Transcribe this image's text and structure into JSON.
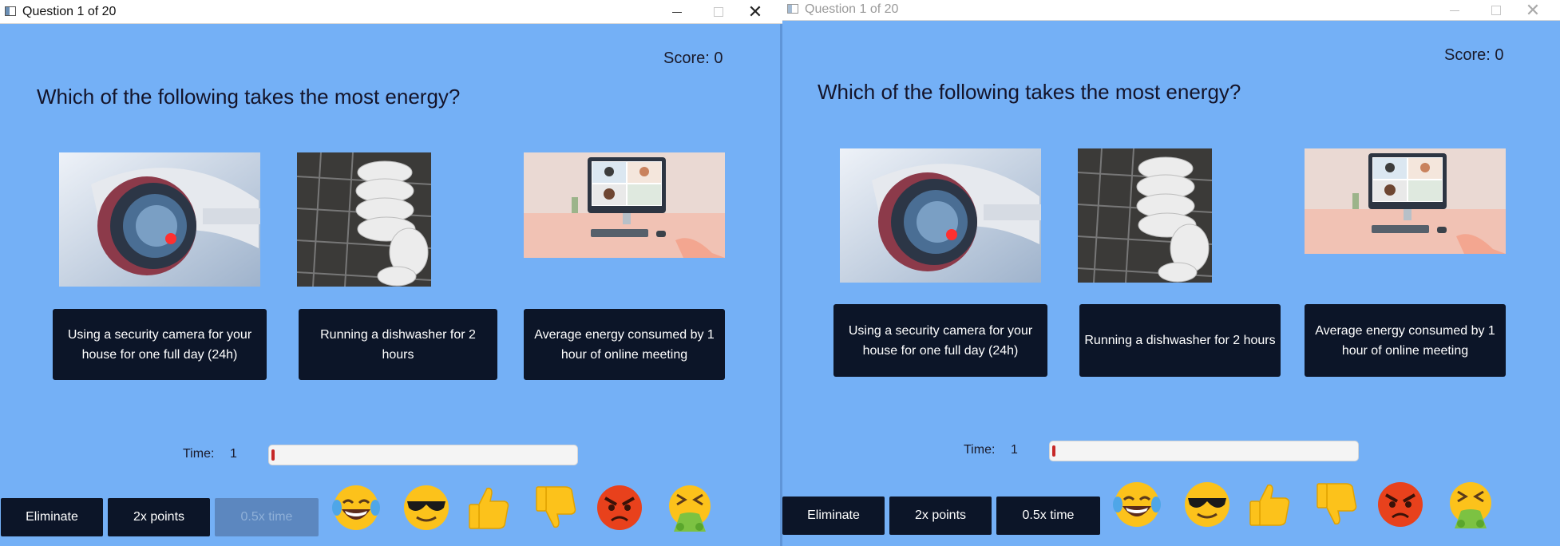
{
  "windows": [
    {
      "title": "Question 1 of 20",
      "score_label": "Score: 0",
      "question": "Which of the following takes the most energy?",
      "answers": [
        {
          "label": "Using a security camera for your house for one full day (24h)",
          "image": "security-camera"
        },
        {
          "label": "Running a dishwasher for 2 hours",
          "image": "dishwasher"
        },
        {
          "label": "Average energy consumed by 1 hour of online meeting",
          "image": "online-meeting"
        }
      ],
      "time_label": "Time:",
      "time_value": "1",
      "time_progress": 0.01,
      "powerups": [
        {
          "label": "Eliminate",
          "enabled": true
        },
        {
          "label": "2x points",
          "enabled": true
        },
        {
          "label": "0.5x time",
          "enabled": false
        }
      ],
      "reactions": [
        "laughing-crying-emoji",
        "sunglasses-emoji",
        "thumbs-up-emoji",
        "thumbs-down-emoji",
        "angry-emoji",
        "vomiting-emoji"
      ]
    },
    {
      "title": "Question 1 of 20",
      "score_label": "Score: 0",
      "question": "Which of the following takes the most energy?",
      "answers": [
        {
          "label": "Using a security camera for your house for one full day (24h)",
          "image": "security-camera"
        },
        {
          "label": "Running a dishwasher for 2 hours",
          "image": "dishwasher"
        },
        {
          "label": "Average energy consumed by 1 hour of online meeting",
          "image": "online-meeting"
        }
      ],
      "time_label": "Time:",
      "time_value": "1",
      "time_progress": 0.01,
      "powerups": [
        {
          "label": "Eliminate",
          "enabled": true
        },
        {
          "label": "2x points",
          "enabled": true
        },
        {
          "label": "0.5x time",
          "enabled": true
        }
      ],
      "reactions": [
        "laughing-crying-emoji",
        "sunglasses-emoji",
        "thumbs-up-emoji",
        "thumbs-down-emoji",
        "angry-emoji",
        "vomiting-emoji"
      ]
    }
  ],
  "colors": {
    "background": "#74b0f6",
    "button": "#0c1528",
    "button_disabled": "#5c87bf",
    "progress_fill": "#c62828"
  }
}
